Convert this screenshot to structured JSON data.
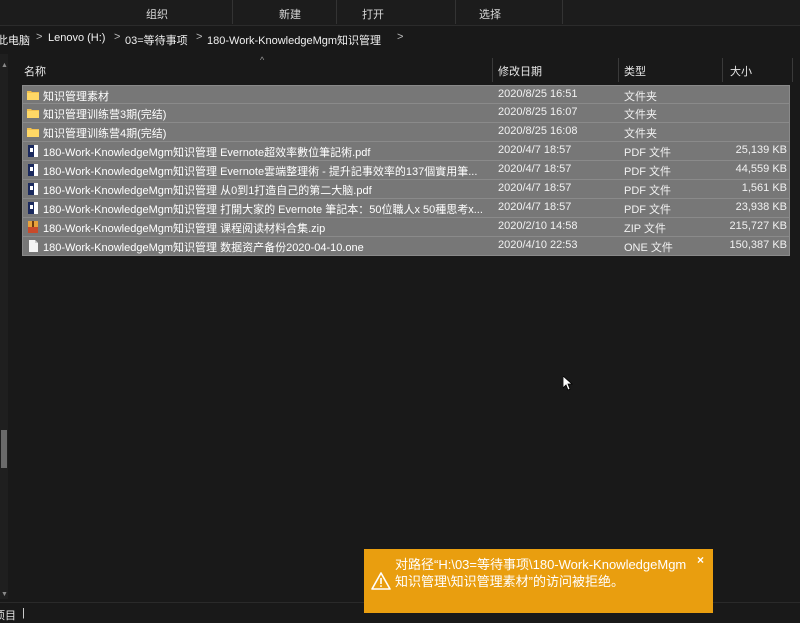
{
  "ribbon": {
    "groups": [
      {
        "label": "组织"
      },
      {
        "label": "新建"
      },
      {
        "label": "打开"
      },
      {
        "label": "选择"
      }
    ]
  },
  "address": {
    "crumbs": [
      "此电脑",
      "Lenovo (H:)",
      "03=等待事项",
      "180-Work-KnowledgeMgm知识管理"
    ],
    "separator": ">"
  },
  "columns": {
    "name": "名称",
    "date": "修改日期",
    "type": "类型",
    "size": "大小",
    "sort_caret": "^"
  },
  "files": [
    {
      "icon": "folder-icon",
      "name": "知识管理素材",
      "date": "2020/8/25 16:51",
      "type": "文件夹",
      "size": ""
    },
    {
      "icon": "folder-icon",
      "name": "知识管理训练营3期(完结)",
      "date": "2020/8/25 16:07",
      "type": "文件夹",
      "size": ""
    },
    {
      "icon": "folder-icon",
      "name": "知识管理训练营4期(完结)",
      "date": "2020/8/25 16:08",
      "type": "文件夹",
      "size": ""
    },
    {
      "icon": "pdf-file-icon",
      "name": "180-Work-KnowledgeMgm知识管理 Evernote超效率數位筆記術.pdf",
      "date": "2020/4/7 18:57",
      "type": "PDF 文件",
      "size": "25,139 KB"
    },
    {
      "icon": "pdf-file-icon",
      "name": "180-Work-KnowledgeMgm知识管理 Evernote雲端整理術 - 提升記事效率的137個實用筆...",
      "date": "2020/4/7 18:57",
      "type": "PDF 文件",
      "size": "44,559 KB"
    },
    {
      "icon": "pdf-file-icon",
      "name": "180-Work-KnowledgeMgm知识管理 从0到1打造自己的第二大脑.pdf",
      "date": "2020/4/7 18:57",
      "type": "PDF 文件",
      "size": "1,561 KB"
    },
    {
      "icon": "pdf-file-icon",
      "name": "180-Work-KnowledgeMgm知识管理 打開大家的 Evernote 筆記本：50位職人x 50種思考x...",
      "date": "2020/4/7 18:57",
      "type": "PDF 文件",
      "size": "23,938 KB"
    },
    {
      "icon": "zip-file-icon",
      "name": "180-Work-KnowledgeMgm知识管理 课程阅读材料合集.zip",
      "date": "2020/2/10 14:58",
      "type": "ZIP 文件",
      "size": "215,727 KB"
    },
    {
      "icon": "one-file-icon",
      "name": "180-Work-KnowledgeMgm知识管理 数据资产备份2020-04-10.one",
      "date": "2020/4/10 22:53",
      "type": "ONE 文件",
      "size": "150,387 KB"
    }
  ],
  "status": {
    "text": "项目",
    "divider": "|"
  },
  "toast": {
    "message": "对路径“H:\\03=等待事项\\180-Work-KnowledgeMgm知识管理\\知识管理素材”的访问被拒绝。",
    "close": "×",
    "color": "#e99e0f"
  }
}
